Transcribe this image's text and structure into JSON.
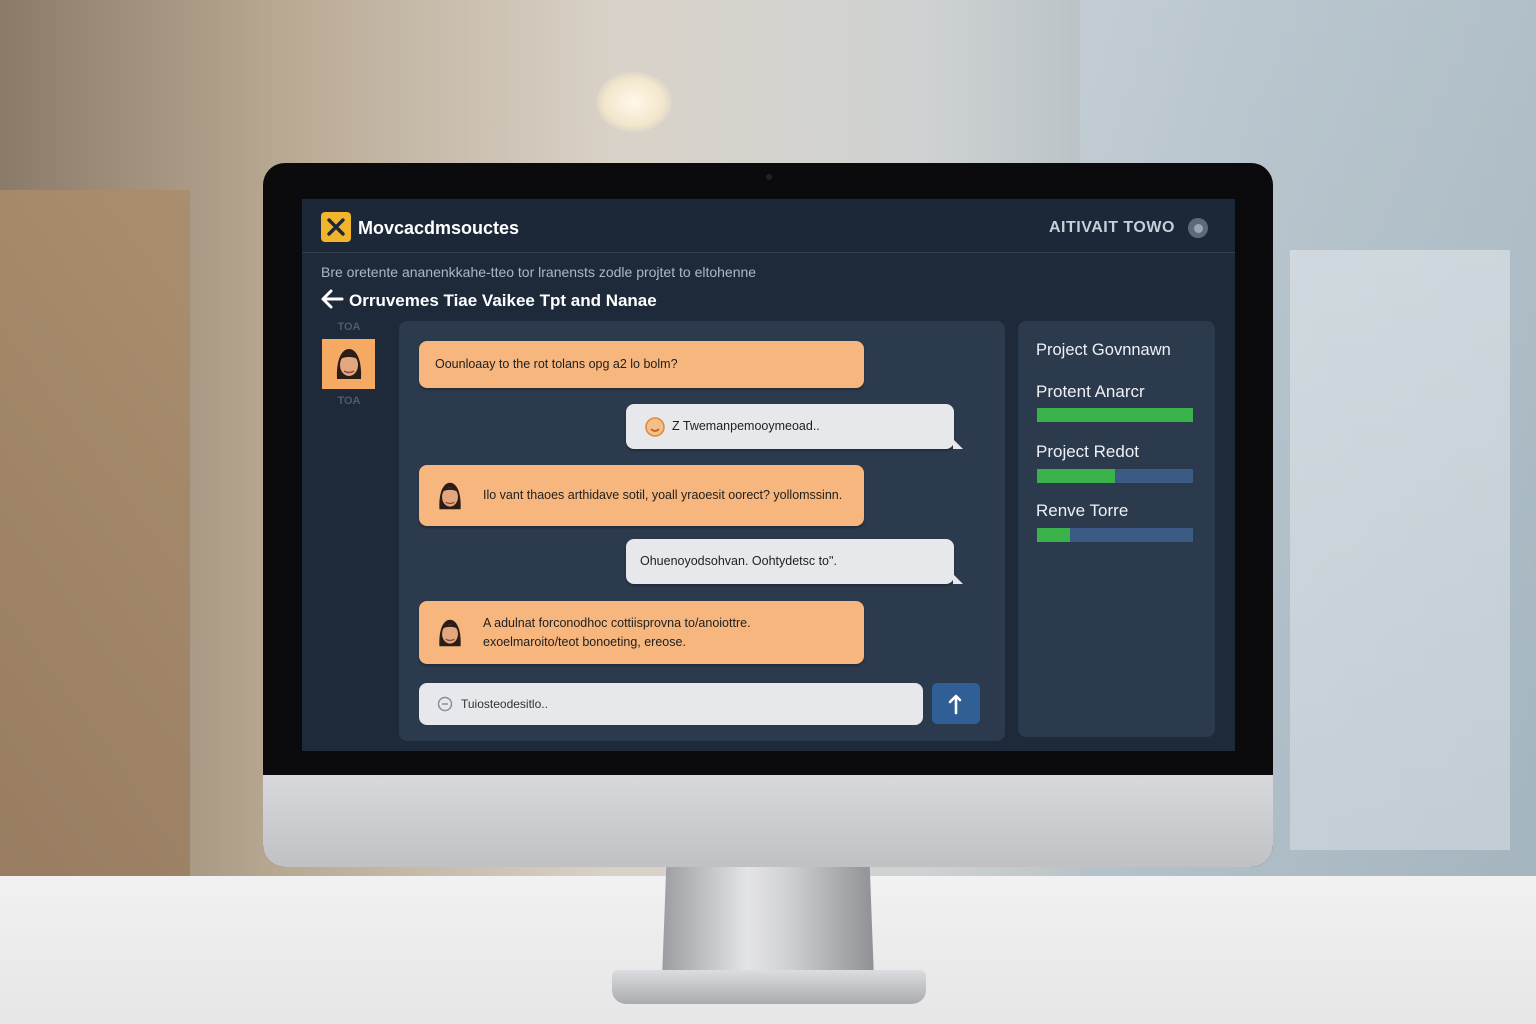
{
  "app": {
    "title": "Movcacdmsouctes",
    "top_right_label": "AITIVAIT TOWO",
    "subtitle": "Bre oretente ananenkkahe-tteo tor lranensts zodle projtet to eltohenne",
    "page_title": "Orruvemes Tiae Vaikee Tpt and Nanae"
  },
  "sidebar": {
    "label_top": "TOA",
    "label_bottom": "TOA"
  },
  "chat": {
    "messages": [
      {
        "side": "in",
        "avatar": false,
        "text": "Oounloaay to the rot tolans opg a2 lo bolm?"
      },
      {
        "side": "out",
        "avatar": true,
        "text": "Z Twemanpemooymeoad.."
      },
      {
        "side": "in",
        "avatar": true,
        "text": "Ilo vant thaoes arthidave sotil, yoall yraoesit oorect? yollomssinn."
      },
      {
        "side": "out",
        "avatar": false,
        "text": "Ohuenoyodsohvan. Oohtydetsc to\"."
      },
      {
        "side": "in",
        "avatar": true,
        "text": "A adulnat forconodhoc cottiisprovna to/anoiottre. exoelmaroito/teot bonoeting, ereose."
      }
    ],
    "input_value": "Tuiosteodesitlo.."
  },
  "project_panel": {
    "title": "Project Govnnawn",
    "items": [
      {
        "label": "Protent Anarcr",
        "progress": 1.0
      },
      {
        "label": "Project Redot",
        "progress": 0.5
      },
      {
        "label": "Renve Torre",
        "progress": 0.21
      }
    ]
  },
  "colors": {
    "accent": "#f1b52c",
    "incoming_bubble": "#f6b67e",
    "outgoing_bubble": "#e7e8eb",
    "progress_fill": "#38b249",
    "progress_track": "#3b5a84",
    "send_button": "#2f5f95"
  },
  "icons": {
    "logo": "x-logo-icon",
    "back": "arrow-left-icon",
    "send": "arrow-up-icon",
    "status": "status-dot-icon"
  }
}
